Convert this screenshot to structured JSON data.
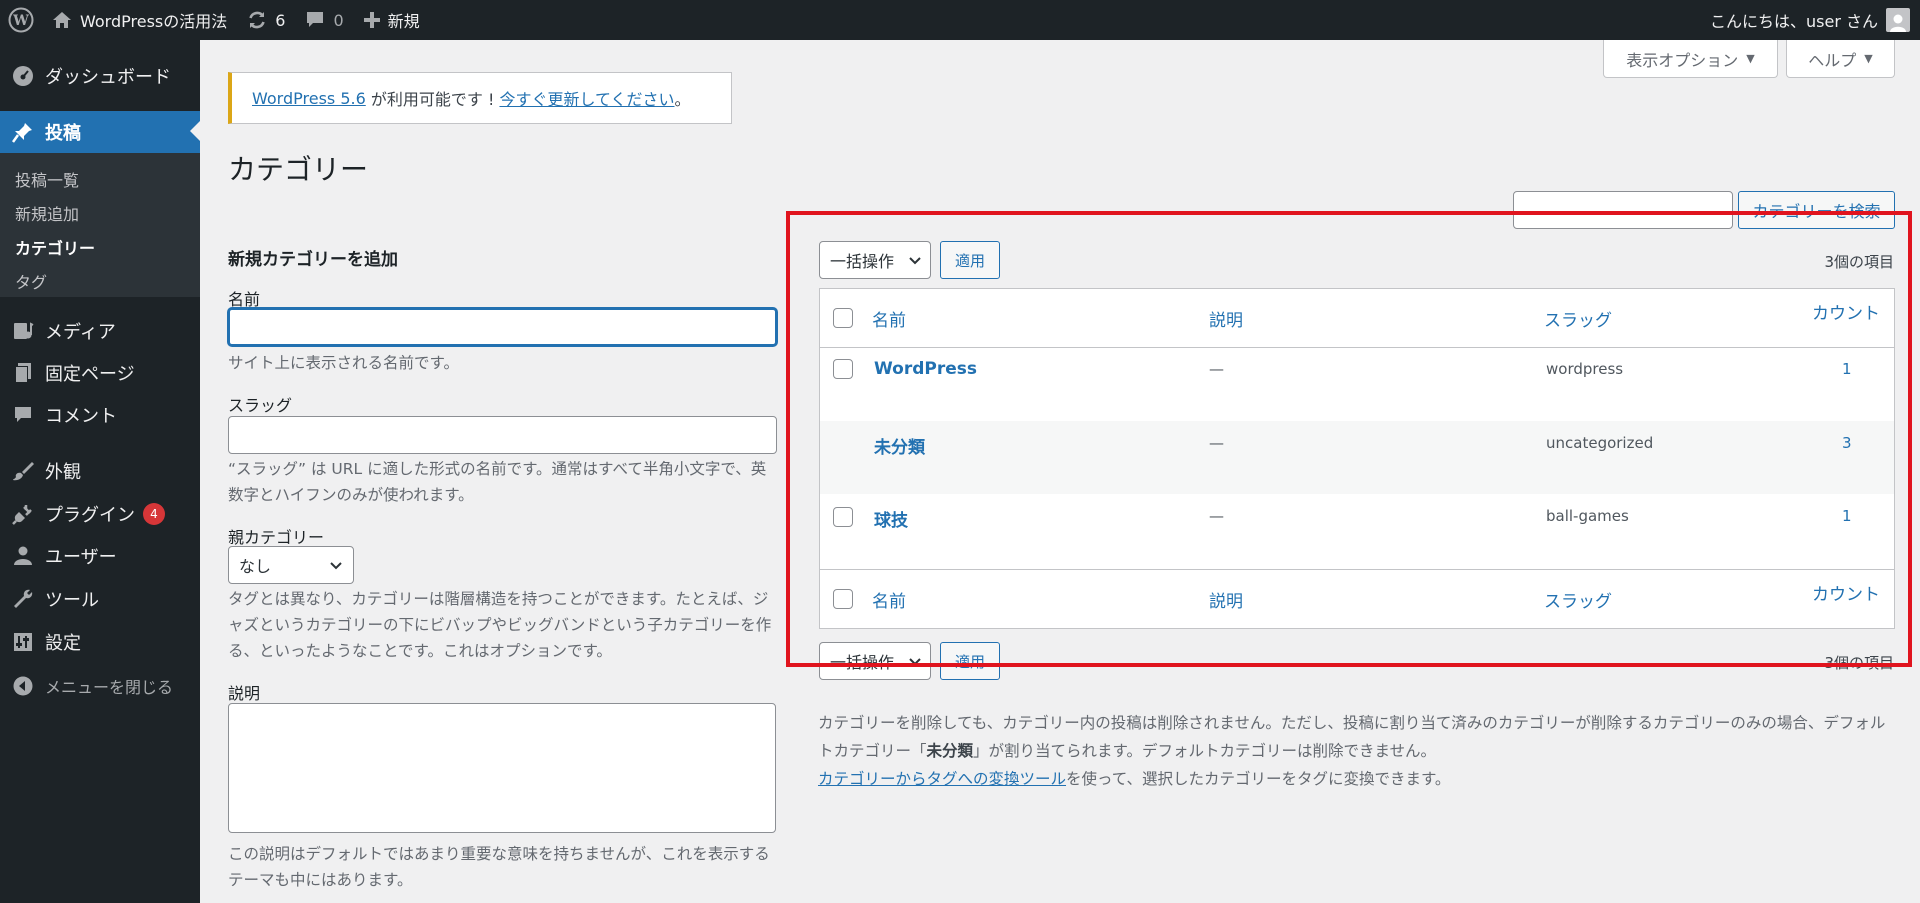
{
  "admin_bar": {
    "site_name": "WordPressの活用法",
    "updates_count": "6",
    "comments_count": "0",
    "new_label": "新規",
    "greeting": "こんにちは、user さん"
  },
  "sidebar": {
    "dashboard": "ダッシュボード",
    "posts": "投稿",
    "sub": {
      "all_posts": "投稿一覧",
      "add_new": "新規追加",
      "categories": "カテゴリー",
      "tags": "タグ"
    },
    "media": "メディア",
    "pages": "固定ページ",
    "comments": "コメント",
    "appearance": "外観",
    "plugins": "プラグイン",
    "plugins_badge": "4",
    "users": "ユーザー",
    "tools": "ツール",
    "settings": "設定",
    "collapse": "メニューを閉じる"
  },
  "top_tabs": {
    "screen_options": "表示オプション",
    "help": "ヘルプ"
  },
  "notice": {
    "version_link": "WordPress 5.6",
    "middle": " が利用可能です ! ",
    "update_link": "今すぐ更新してください",
    "end": "。"
  },
  "page_title": "カテゴリー",
  "search": {
    "value": "",
    "button": "カテゴリーを検索"
  },
  "form": {
    "heading": "新規カテゴリーを追加",
    "name_label": "名前",
    "name_value": "",
    "name_desc": "サイト上に表示される名前です。",
    "slug_label": "スラッグ",
    "slug_value": "",
    "slug_desc": "“スラッグ” は URL に適した形式の名前です。通常はすべて半角小文字で、英数字とハイフンのみが使われます。",
    "parent_label": "親カテゴリー",
    "parent_value": "なし",
    "parent_desc": "タグとは異なり、カテゴリーは階層構造を持つことができます。たとえば、ジャズというカテゴリーの下にビバップやビッグバンドという子カテゴリーを作る、といったようなことです。これはオプションです。",
    "description_label": "説明",
    "description_value": "",
    "description_desc": "この説明はデフォルトではあまり重要な意味を持ちませんが、これを表示するテーマも中にはあります。"
  },
  "table": {
    "bulk_action": "一括操作",
    "apply": "適用",
    "items_count": "3個の項目",
    "columns": {
      "name": "名前",
      "description": "説明",
      "slug": "スラッグ",
      "count": "カウント"
    },
    "rows": [
      {
        "name": "WordPress",
        "description": "—",
        "slug": "wordpress",
        "count": "1"
      },
      {
        "name": "未分類",
        "description": "—",
        "slug": "uncategorized",
        "count": "3"
      },
      {
        "name": "球技",
        "description": "—",
        "slug": "ball-games",
        "count": "1"
      }
    ]
  },
  "bottom_note": {
    "line1_before": "カテゴリーを削除しても、カテゴリー内の投稿は削除されません。ただし、投稿に割り当て済みのカテゴリーが削除するカテゴリーのみの場合、デフォルトカテゴリー「",
    "line1_bold": "未分類",
    "line1_after": "」が割り当てられます。デフォルトカテゴリーは削除できません。",
    "link": "カテゴリーからタグへの変換ツール",
    "line2_after": "を使って、選択したカテゴリーをタグに変換できます。"
  },
  "colors": {
    "admin_bar": "#1d2327",
    "accent": "#2271b1",
    "highlight_box": "#e0141e",
    "notice_border": "#dba617",
    "badge": "#d63638"
  }
}
